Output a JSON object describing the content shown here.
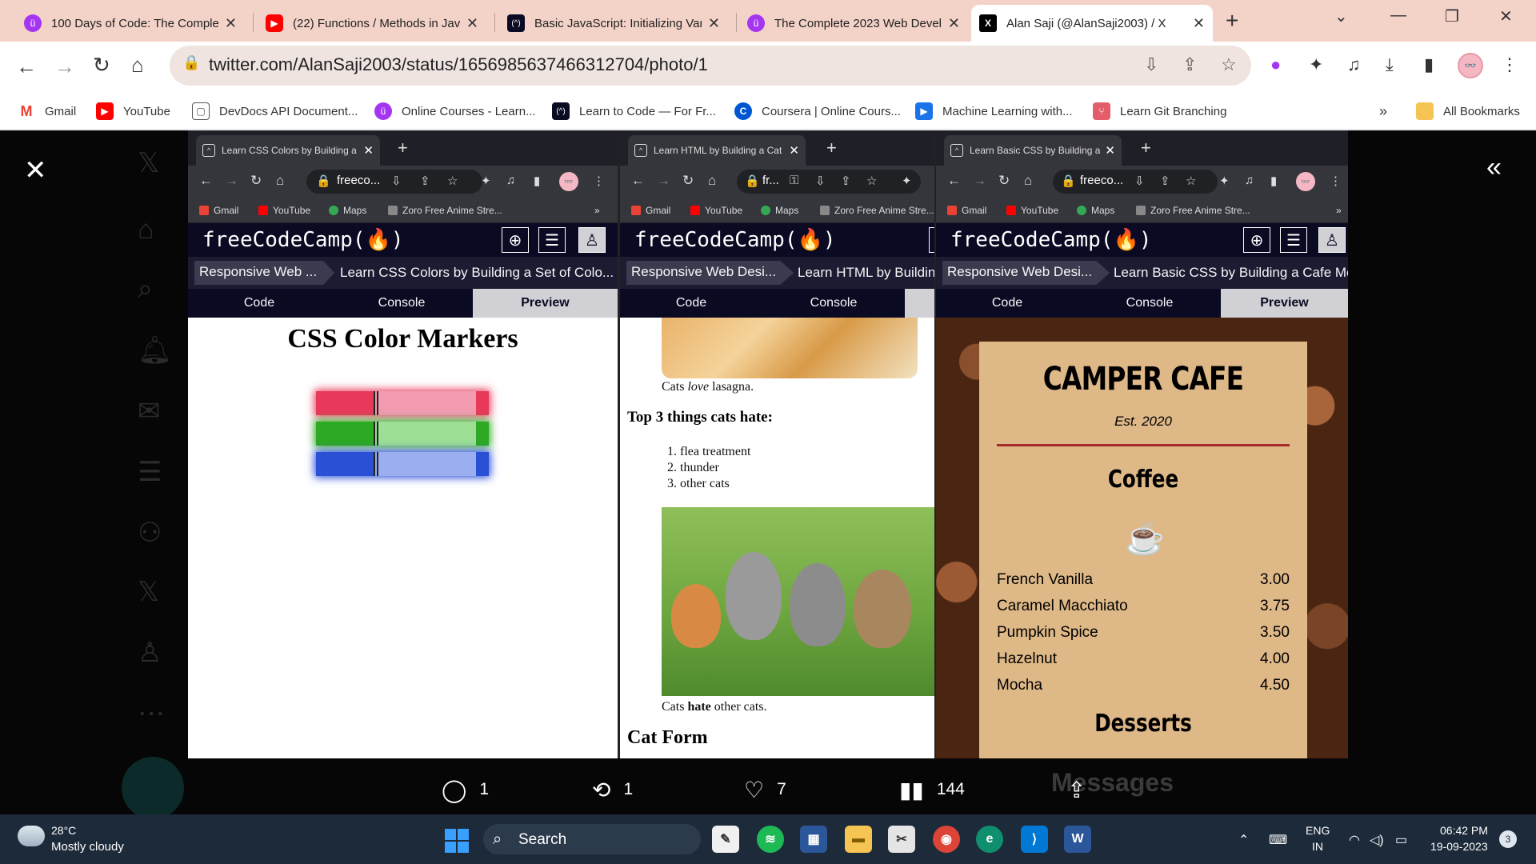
{
  "browser": {
    "tabs": [
      {
        "title": "100 Days of Code: The Complete",
        "color": "#a435f0",
        "glyph": "ü"
      },
      {
        "title": "(22) Functions / Methods in Java",
        "color": "#ff0000",
        "glyph": "▶"
      },
      {
        "title": "Basic JavaScript: Initializing Var",
        "color": "#0a0a23",
        "glyph": "(^)"
      },
      {
        "title": "The Complete 2023 Web Devel",
        "color": "#a435f0",
        "glyph": "ü"
      },
      {
        "title": "Alan Saji (@AlanSaji2003) / X",
        "color": "#000000",
        "glyph": "X"
      }
    ],
    "url": "twitter.com/AlanSaji2003/status/1656985637466312704/photo/1",
    "bookmarks": [
      "Gmail",
      "YouTube",
      "DevDocs API Document...",
      "Online Courses - Learn...",
      "Learn to Code — For Fr...",
      "Coursera | Online Cours...",
      "Machine Learning with...",
      "Learn Git Branching"
    ],
    "more_bookmarks": "»",
    "all_bookmarks": "All Bookmarks"
  },
  "inner_common": {
    "bookmarks": [
      "Gmail",
      "YouTube",
      "Maps",
      "Zoro Free Anime Stre..."
    ],
    "more": "»",
    "logo": "freeCodeCamp(🔥)",
    "tabs": [
      "Code",
      "Console",
      "Preview"
    ]
  },
  "browser1": {
    "tab_title": "Learn CSS Colors by Building a S",
    "url": "freeco...",
    "crumb1": "Responsive Web ...",
    "crumb2": "Learn CSS Colors by Building a Set of Colo...",
    "preview_title": "CSS Color Markers",
    "markers": [
      {
        "cap": "#e8395b",
        "sleeve": "#f29bb1",
        "tip": "#e8395b"
      },
      {
        "cap": "#2ea923",
        "sleeve": "#9cdf95",
        "tip": "#2ea923"
      },
      {
        "cap": "#2a50d6",
        "sleeve": "#9aaef0",
        "tip": "#2a50d6"
      }
    ]
  },
  "browser2": {
    "tab_title": "Learn HTML by Building a Cat Pl",
    "url": "fr...",
    "crumb1": "Responsive Web Desi...",
    "crumb2": "Learn HTML by Buildin",
    "caption1_a": "Cats ",
    "caption1_em": "love",
    "caption1_b": " lasagna.",
    "hate_heading": "Top 3 things cats hate:",
    "hate_list": [
      "flea treatment",
      "thunder",
      "other cats"
    ],
    "caption2_a": "Cats ",
    "caption2_strong": "hate",
    "caption2_b": " other cats.",
    "form_heading": "Cat Form"
  },
  "browser3": {
    "tab_title": "Learn Basic CSS by Building a Ca",
    "url": "freeco...",
    "crumb1": "Responsive Web Desi...",
    "crumb2": "Learn Basic CSS by Building a Cafe Me...",
    "cafe_name": "CAMPER CAFE",
    "est": "Est. 2020",
    "coffee_heading": "Coffee",
    "coffee_items": [
      {
        "name": "French Vanilla",
        "price": "3.00"
      },
      {
        "name": "Caramel Macchiato",
        "price": "3.75"
      },
      {
        "name": "Pumpkin Spice",
        "price": "3.50"
      },
      {
        "name": "Hazelnut",
        "price": "4.00"
      },
      {
        "name": "Mocha",
        "price": "4.50"
      }
    ],
    "desserts_heading": "Desserts"
  },
  "actions": {
    "replies": "1",
    "reposts": "1",
    "likes": "7",
    "views": "144"
  },
  "background": {
    "messages_label": "Messages"
  },
  "taskbar": {
    "temp": "28°C",
    "weather": "Mostly cloudy",
    "search": "Search",
    "lang1": "ENG",
    "lang2": "IN",
    "time": "06:42 PM",
    "date": "19-09-2023",
    "notifications": "3"
  }
}
